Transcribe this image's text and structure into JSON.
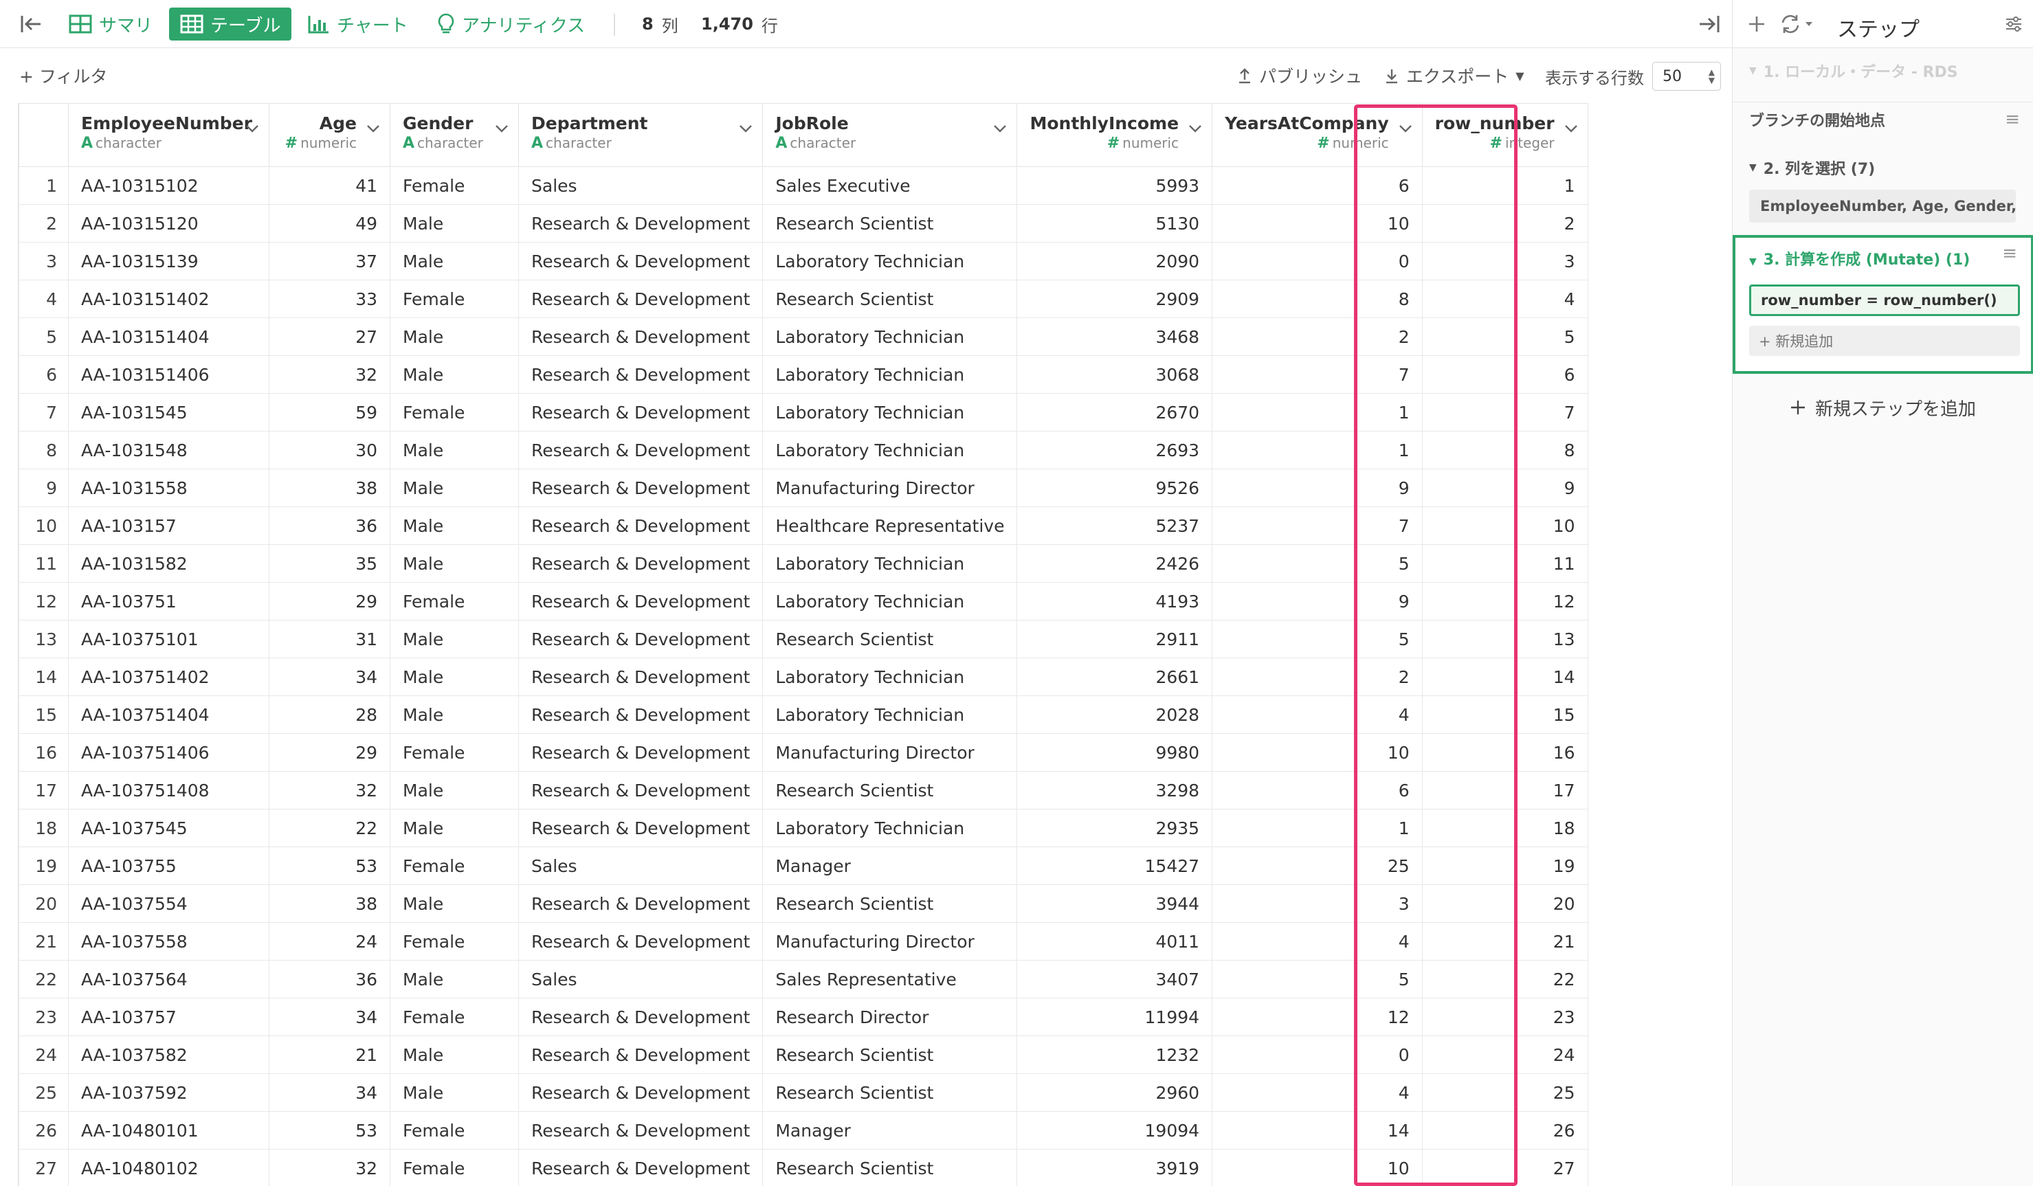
{
  "topbar": {
    "tabs": [
      {
        "label": "サマリ",
        "icon": "grid-icon"
      },
      {
        "label": "テーブル",
        "icon": "table-icon"
      },
      {
        "label": "チャート",
        "icon": "bar-chart-icon"
      },
      {
        "label": "アナリティクス",
        "icon": "lightbulb-icon"
      }
    ],
    "columns_count": "8",
    "columns_unit": "列",
    "rows_count": "1,470",
    "rows_unit": "行"
  },
  "toolbar": {
    "filter": "+ フィルタ",
    "publish": "パブリッシュ",
    "export": "エクスポート",
    "rows_label": "表示する行数",
    "rows_value": "50"
  },
  "table": {
    "columns": [
      {
        "name": "EmployeeNumber",
        "type": "character",
        "kind": "A"
      },
      {
        "name": "Age",
        "type": "numeric",
        "kind": "#"
      },
      {
        "name": "Gender",
        "type": "character",
        "kind": "A"
      },
      {
        "name": "Department",
        "type": "character",
        "kind": "A"
      },
      {
        "name": "JobRole",
        "type": "character",
        "kind": "A"
      },
      {
        "name": "MonthlyIncome",
        "type": "numeric",
        "kind": "#"
      },
      {
        "name": "YearsAtCompany",
        "type": "numeric",
        "kind": "#"
      },
      {
        "name": "row_number",
        "type": "integer",
        "kind": "#"
      }
    ],
    "rows": [
      [
        "1",
        "AA-10315102",
        "41",
        "Female",
        "Sales",
        "Sales Executive",
        "5993",
        "6",
        "1"
      ],
      [
        "2",
        "AA-10315120",
        "49",
        "Male",
        "Research & Development",
        "Research Scientist",
        "5130",
        "10",
        "2"
      ],
      [
        "3",
        "AA-10315139",
        "37",
        "Male",
        "Research & Development",
        "Laboratory Technician",
        "2090",
        "0",
        "3"
      ],
      [
        "4",
        "AA-103151402",
        "33",
        "Female",
        "Research & Development",
        "Research Scientist",
        "2909",
        "8",
        "4"
      ],
      [
        "5",
        "AA-103151404",
        "27",
        "Male",
        "Research & Development",
        "Laboratory Technician",
        "3468",
        "2",
        "5"
      ],
      [
        "6",
        "AA-103151406",
        "32",
        "Male",
        "Research & Development",
        "Laboratory Technician",
        "3068",
        "7",
        "6"
      ],
      [
        "7",
        "AA-1031545",
        "59",
        "Female",
        "Research & Development",
        "Laboratory Technician",
        "2670",
        "1",
        "7"
      ],
      [
        "8",
        "AA-1031548",
        "30",
        "Male",
        "Research & Development",
        "Laboratory Technician",
        "2693",
        "1",
        "8"
      ],
      [
        "9",
        "AA-1031558",
        "38",
        "Male",
        "Research & Development",
        "Manufacturing Director",
        "9526",
        "9",
        "9"
      ],
      [
        "10",
        "AA-103157",
        "36",
        "Male",
        "Research & Development",
        "Healthcare Representative",
        "5237",
        "7",
        "10"
      ],
      [
        "11",
        "AA-1031582",
        "35",
        "Male",
        "Research & Development",
        "Laboratory Technician",
        "2426",
        "5",
        "11"
      ],
      [
        "12",
        "AA-103751",
        "29",
        "Female",
        "Research & Development",
        "Laboratory Technician",
        "4193",
        "9",
        "12"
      ],
      [
        "13",
        "AA-10375101",
        "31",
        "Male",
        "Research & Development",
        "Research Scientist",
        "2911",
        "5",
        "13"
      ],
      [
        "14",
        "AA-103751402",
        "34",
        "Male",
        "Research & Development",
        "Laboratory Technician",
        "2661",
        "2",
        "14"
      ],
      [
        "15",
        "AA-103751404",
        "28",
        "Male",
        "Research & Development",
        "Laboratory Technician",
        "2028",
        "4",
        "15"
      ],
      [
        "16",
        "AA-103751406",
        "29",
        "Female",
        "Research & Development",
        "Manufacturing Director",
        "9980",
        "10",
        "16"
      ],
      [
        "17",
        "AA-103751408",
        "32",
        "Male",
        "Research & Development",
        "Research Scientist",
        "3298",
        "6",
        "17"
      ],
      [
        "18",
        "AA-1037545",
        "22",
        "Male",
        "Research & Development",
        "Laboratory Technician",
        "2935",
        "1",
        "18"
      ],
      [
        "19",
        "AA-103755",
        "53",
        "Female",
        "Sales",
        "Manager",
        "15427",
        "25",
        "19"
      ],
      [
        "20",
        "AA-1037554",
        "38",
        "Male",
        "Research & Development",
        "Research Scientist",
        "3944",
        "3",
        "20"
      ],
      [
        "21",
        "AA-1037558",
        "24",
        "Female",
        "Research & Development",
        "Manufacturing Director",
        "4011",
        "4",
        "21"
      ],
      [
        "22",
        "AA-1037564",
        "36",
        "Male",
        "Sales",
        "Sales Representative",
        "3407",
        "5",
        "22"
      ],
      [
        "23",
        "AA-103757",
        "34",
        "Female",
        "Research & Development",
        "Research Director",
        "11994",
        "12",
        "23"
      ],
      [
        "24",
        "AA-1037582",
        "21",
        "Male",
        "Research & Development",
        "Research Scientist",
        "1232",
        "0",
        "24"
      ],
      [
        "25",
        "AA-1037592",
        "34",
        "Male",
        "Research & Development",
        "Research Scientist",
        "2960",
        "4",
        "25"
      ],
      [
        "26",
        "AA-10480101",
        "53",
        "Female",
        "Research & Development",
        "Manager",
        "19094",
        "14",
        "26"
      ],
      [
        "27",
        "AA-10480102",
        "32",
        "Female",
        "Research & Development",
        "Research Scientist",
        "3919",
        "10",
        "27"
      ]
    ]
  },
  "panel": {
    "title": "ステップ",
    "source_step": "1. ローカル・データ - RDS",
    "branch_start": "ブランチの開始地点",
    "select_step": "2. 列を選択 (7)",
    "select_columns": "EmployeeNumber, Age, Gender, ...",
    "mutate_step": "3. 計算を作成 (Mutate) (1)",
    "mutate_expr": "row_number = row_number()",
    "mutate_add": "+ 新規追加",
    "add_step": "新規ステップを追加"
  },
  "colors": {
    "accent": "#2ea56b",
    "highlight": "#e8336f"
  }
}
